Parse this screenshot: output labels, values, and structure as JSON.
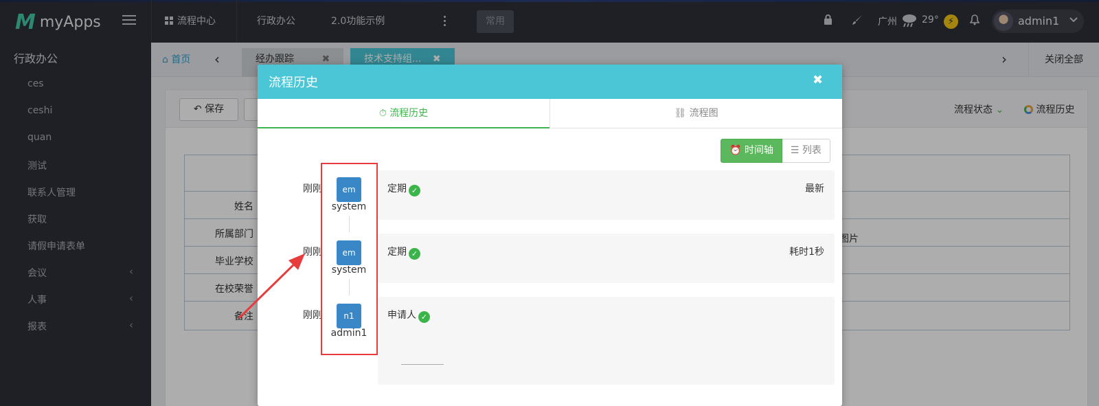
{
  "app": {
    "logo_mark": "M",
    "logo_text": "myApps"
  },
  "topnav": {
    "items": [
      "流程中心",
      "行政办公",
      "2.0功能示例"
    ],
    "common_button": "常用",
    "city": "广州",
    "temperature": "29°",
    "username": "admin1"
  },
  "sidebar": {
    "title": "行政办公",
    "items": [
      {
        "label": "ces"
      },
      {
        "label": "ceshi"
      },
      {
        "label": "quan"
      },
      {
        "label": "测试"
      },
      {
        "label": "联系人管理"
      },
      {
        "label": "获取"
      },
      {
        "label": "请假申请表单"
      },
      {
        "label": "会议"
      },
      {
        "label": "人事"
      },
      {
        "label": "报表"
      }
    ]
  },
  "tabs": {
    "home": "首页",
    "items": [
      {
        "label": "经办跟踪"
      },
      {
        "label": "技术支持组..."
      }
    ],
    "close_all": "关闭全部"
  },
  "form": {
    "save_label": "保存",
    "flow_state": "流程状态",
    "flow_history": "流程历史",
    "fields": [
      "姓名",
      "所属部门",
      "毕业学校",
      "在校荣誉",
      "备注"
    ],
    "side_text": "图片"
  },
  "modal": {
    "title": "流程历史",
    "tabs": [
      "流程历史",
      "流程图"
    ],
    "view_timeline": "时间轴",
    "view_list": "列表",
    "entries": [
      {
        "time": "刚刚",
        "node": "em",
        "user": "system",
        "step": "定期",
        "meta": "最新"
      },
      {
        "time": "刚刚",
        "node": "em",
        "user": "system",
        "step": "定期",
        "meta": "耗时1秒"
      },
      {
        "time": "刚刚",
        "node": "n1",
        "user": "admin1",
        "step": "申请人",
        "meta": ""
      }
    ]
  },
  "colors": {
    "accent": "#4ac6d6",
    "success": "#3bb54a",
    "highlight": "#e83b3b",
    "brand": "#41c9a7"
  }
}
